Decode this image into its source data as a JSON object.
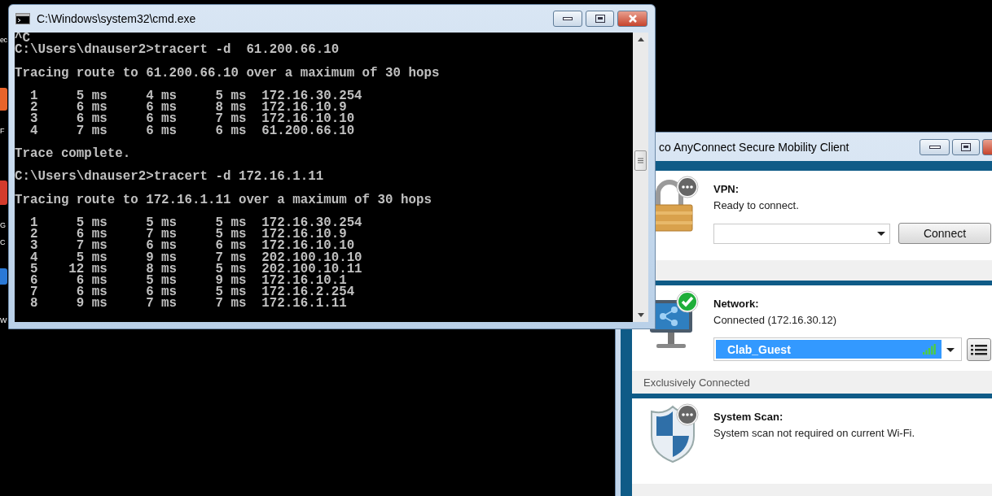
{
  "desktop": {
    "icon_labels": [
      "ec",
      "F",
      "G",
      "C",
      "W"
    ]
  },
  "console_window": {
    "title": "C:\\Windows\\system32\\cmd.exe",
    "blocks": [
      {
        "lines": [
          "^C",
          "C:\\Users\\dnauser2>tracert -d  61.200.66.10"
        ]
      },
      {
        "lines": [
          "Tracing route to 61.200.66.10 over a maximum of 30 hops"
        ]
      },
      {
        "lines": [
          "  1     5 ms     4 ms     5 ms  172.16.30.254",
          "  2     6 ms     6 ms     8 ms  172.16.10.9",
          "  3     6 ms     6 ms     7 ms  172.16.10.10",
          "  4     7 ms     6 ms     6 ms  61.200.66.10"
        ]
      },
      {
        "lines": [
          "Trace complete."
        ]
      },
      {
        "lines": [
          "C:\\Users\\dnauser2>tracert -d 172.16.1.11"
        ]
      },
      {
        "lines": [
          "Tracing route to 172.16.1.11 over a maximum of 30 hops"
        ]
      },
      {
        "lines": [
          "  1     5 ms     5 ms     5 ms  172.16.30.254",
          "  2     6 ms     7 ms     5 ms  172.16.10.9",
          "  3     7 ms     6 ms     6 ms  172.16.10.10",
          "  4     5 ms     9 ms     7 ms  202.100.10.10",
          "  5    12 ms     8 ms     5 ms  202.100.10.11",
          "  6     6 ms     5 ms     9 ms  172.16.10.1",
          "  7     6 ms     6 ms     5 ms  172.16.2.254",
          "  8     9 ms     7 ms     7 ms  172.16.1.11"
        ]
      }
    ]
  },
  "anyconnect_window": {
    "title": "co AnyConnect Secure Mobility Client",
    "sections": [
      {
        "kind": "vpn",
        "connected": false,
        "heading": "VPN:",
        "status": "Ready to connect.",
        "button": "Connect"
      },
      {
        "kind": "network",
        "connected": true,
        "heading": "Network:",
        "status": "Connected (172.16.30.12)",
        "network": "Clab_Guest",
        "footer": "Exclusively Connected"
      },
      {
        "kind": "scan",
        "connected": false,
        "heading": "System Scan:",
        "status": "System scan not required on current Wi-Fi."
      }
    ]
  }
}
